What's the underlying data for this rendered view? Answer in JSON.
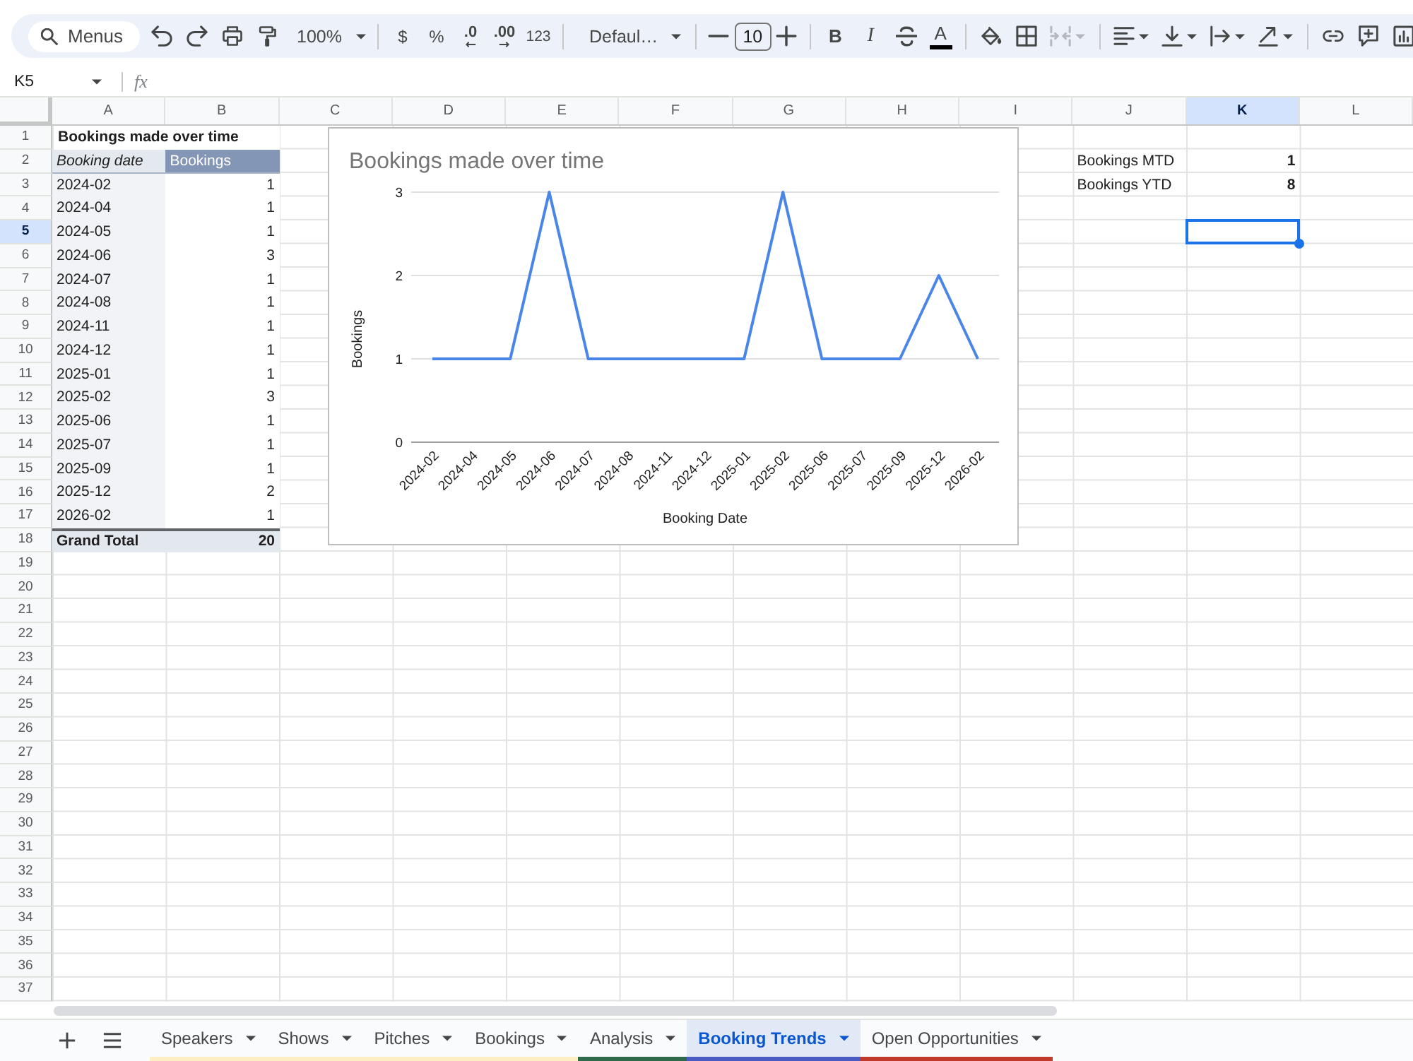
{
  "toolbar": {
    "menu_search": {
      "placeholder": "Menus"
    },
    "zoom": "100%",
    "currency": "$",
    "percent": "%",
    "decrease_decimals": ".0",
    "increase_decimals": ".00",
    "more_formats": "123",
    "font": "Defaul…",
    "font_size": "10",
    "bold": "B",
    "italic": "I",
    "text_color": "A",
    "merge_cells": {
      "disabled": true
    }
  },
  "formula_bar": {
    "name_box": "K5",
    "function_label": "fx"
  },
  "column_headers": [
    {
      "label": "A",
      "selected": false
    },
    {
      "label": "B",
      "selected": false
    },
    {
      "label": "C",
      "selected": false
    },
    {
      "label": "D",
      "selected": false
    },
    {
      "label": "E",
      "selected": false
    },
    {
      "label": "F",
      "selected": false
    },
    {
      "label": "G",
      "selected": false
    },
    {
      "label": "H",
      "selected": false
    },
    {
      "label": "I",
      "selected": false
    },
    {
      "label": "J",
      "selected": false
    },
    {
      "label": "K",
      "selected": true
    },
    {
      "label": "L",
      "selected": false
    }
  ],
  "row_headers": [
    {
      "label": "1",
      "selected": false
    },
    {
      "label": "2",
      "selected": false
    },
    {
      "label": "3",
      "selected": false
    },
    {
      "label": "4",
      "selected": false
    },
    {
      "label": "5",
      "selected": true
    },
    {
      "label": "6",
      "selected": false
    },
    {
      "label": "7",
      "selected": false
    },
    {
      "label": "8",
      "selected": false
    },
    {
      "label": "9",
      "selected": false
    },
    {
      "label": "10",
      "selected": false
    },
    {
      "label": "11",
      "selected": false
    },
    {
      "label": "12",
      "selected": false
    },
    {
      "label": "13",
      "selected": false
    },
    {
      "label": "14",
      "selected": false
    },
    {
      "label": "15",
      "selected": false
    },
    {
      "label": "16",
      "selected": false
    },
    {
      "label": "17",
      "selected": false
    },
    {
      "label": "18",
      "selected": false
    },
    {
      "label": "19",
      "selected": false
    },
    {
      "label": "20",
      "selected": false
    },
    {
      "label": "21",
      "selected": false
    },
    {
      "label": "22",
      "selected": false
    },
    {
      "label": "23",
      "selected": false
    },
    {
      "label": "24",
      "selected": false
    },
    {
      "label": "25",
      "selected": false
    },
    {
      "label": "26",
      "selected": false
    },
    {
      "label": "27",
      "selected": false
    },
    {
      "label": "28",
      "selected": false
    },
    {
      "label": "29",
      "selected": false
    },
    {
      "label": "30",
      "selected": false
    },
    {
      "label": "31",
      "selected": false
    },
    {
      "label": "32",
      "selected": false
    },
    {
      "label": "33",
      "selected": false
    },
    {
      "label": "34",
      "selected": false
    },
    {
      "label": "35",
      "selected": false
    },
    {
      "label": "36",
      "selected": false
    },
    {
      "label": "37",
      "selected": false
    }
  ],
  "pivot_table": {
    "title": "Bookings made over time",
    "headers": [
      "Booking date",
      "Bookings"
    ],
    "rows": [
      {
        "date": "2024-02",
        "bookings": "1"
      },
      {
        "date": "2024-04",
        "bookings": "1"
      },
      {
        "date": "2024-05",
        "bookings": "1"
      },
      {
        "date": "2024-06",
        "bookings": "3"
      },
      {
        "date": "2024-07",
        "bookings": "1"
      },
      {
        "date": "2024-08",
        "bookings": "1"
      },
      {
        "date": "2024-11",
        "bookings": "1"
      },
      {
        "date": "2024-12",
        "bookings": "1"
      },
      {
        "date": "2025-01",
        "bookings": "1"
      },
      {
        "date": "2025-02",
        "bookings": "3"
      },
      {
        "date": "2025-06",
        "bookings": "1"
      },
      {
        "date": "2025-07",
        "bookings": "1"
      },
      {
        "date": "2025-09",
        "bookings": "1"
      },
      {
        "date": "2025-12",
        "bookings": "2"
      },
      {
        "date": "2026-02",
        "bookings": "1"
      }
    ],
    "total": {
      "label": "Grand Total",
      "value": "20"
    }
  },
  "summary": [
    {
      "label": "Bookings MTD",
      "value": "1"
    },
    {
      "label": "Bookings YTD",
      "value": "8"
    }
  ],
  "chart": {
    "chart_data": {
      "type": "line",
      "title": "Bookings made over time",
      "xlabel": "Booking Date",
      "ylabel": "Bookings",
      "categories": [
        "2024-02",
        "2024-04",
        "2024-05",
        "2024-06",
        "2024-07",
        "2024-08",
        "2024-11",
        "2024-12",
        "2025-01",
        "2025-02",
        "2025-06",
        "2025-07",
        "2025-09",
        "2025-12",
        "2026-02"
      ],
      "series": [
        {
          "color": "#4a86e8",
          "values": [
            1,
            1,
            1,
            3,
            1,
            1,
            1,
            1,
            1,
            3,
            1,
            1,
            1,
            2,
            1
          ]
        }
      ],
      "ylim": [
        0,
        3
      ],
      "yticks": [
        0,
        1,
        2,
        3
      ]
    }
  },
  "sheet_tabs": [
    {
      "label": "Speakers",
      "selected": false,
      "color": "#fdefc3"
    },
    {
      "label": "Shows",
      "selected": false,
      "color": "#fdefc3"
    },
    {
      "label": "Pitches",
      "selected": false,
      "color": "#fdefc3"
    },
    {
      "label": "Bookings",
      "selected": false,
      "color": "#fdefc3"
    },
    {
      "label": "Analysis",
      "selected": false,
      "color": "#2f6b4a"
    },
    {
      "label": "Booking Trends",
      "selected": true,
      "color": "#4a5bc4"
    },
    {
      "label": "Open Opportunities",
      "selected": false,
      "color": "#c0392b"
    }
  ]
}
